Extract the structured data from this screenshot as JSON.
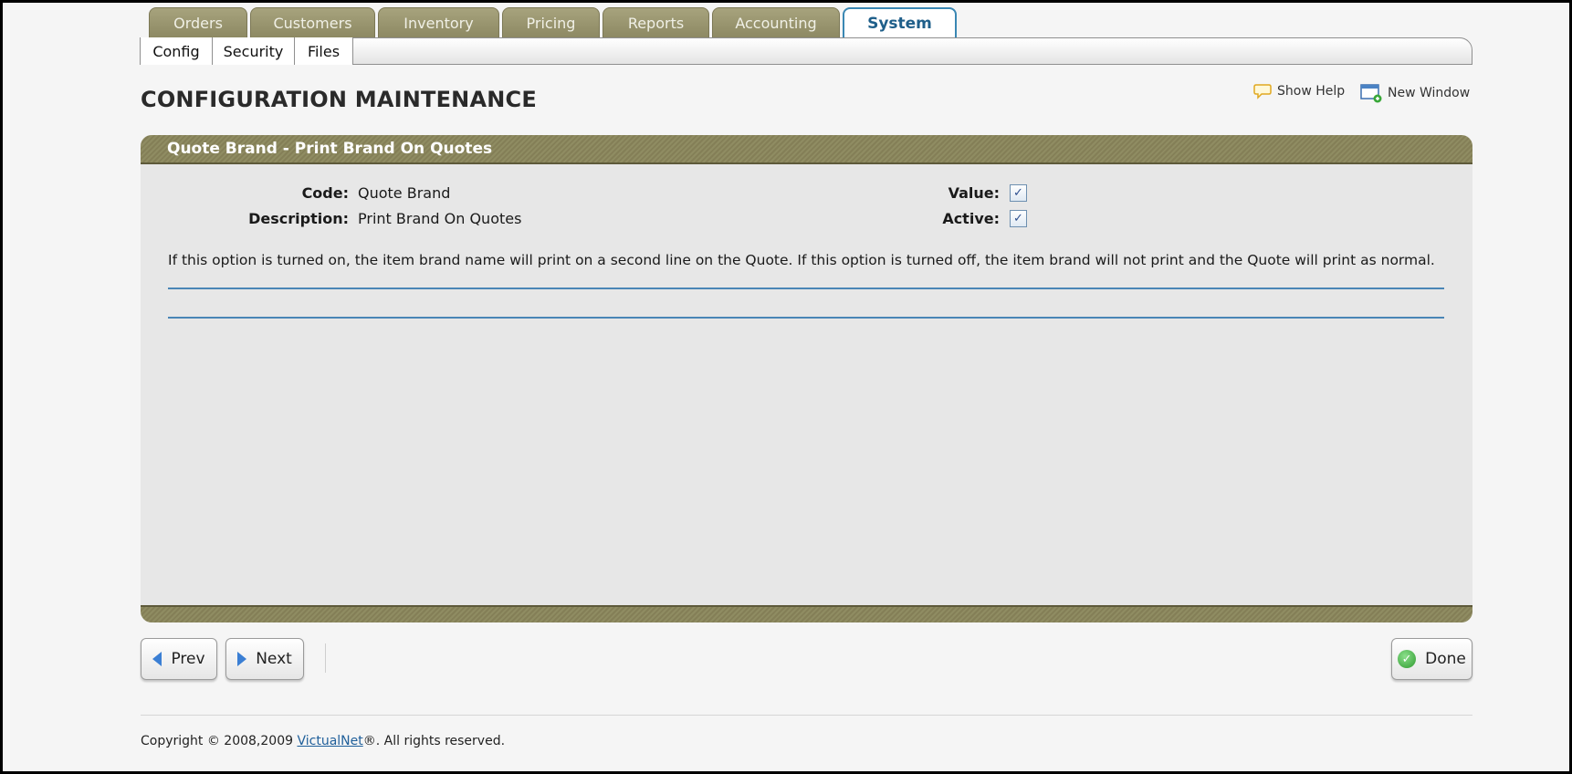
{
  "nav": {
    "tabs": [
      {
        "label": "Orders"
      },
      {
        "label": "Customers"
      },
      {
        "label": "Inventory"
      },
      {
        "label": "Pricing"
      },
      {
        "label": "Reports"
      },
      {
        "label": "Accounting"
      },
      {
        "label": "System"
      }
    ],
    "active_tab": "System",
    "subnav": [
      {
        "label": "Config"
      },
      {
        "label": "Security"
      },
      {
        "label": "Files"
      }
    ]
  },
  "page": {
    "title": "CONFIGURATION MAINTENANCE",
    "show_help": "Show Help",
    "new_window": "New Window"
  },
  "panel": {
    "header": "Quote Brand - Print Brand On Quotes",
    "code_label": "Code:",
    "code_value": "Quote Brand",
    "description_label": "Description:",
    "description_value": "Print Brand On Quotes",
    "value_label": "Value:",
    "value_checked": true,
    "active_label": "Active:",
    "active_checked": true,
    "help_text": "If this option is turned on, the item brand name will print on a second line on the Quote. If this option is turned off, the item brand will not print and the Quote will print as normal."
  },
  "buttons": {
    "prev": "Prev",
    "next": "Next",
    "done": "Done"
  },
  "footer": {
    "prefix": "Copyright © 2008,2009 ",
    "link": "VictualNet",
    "suffix": "®. All rights reserved."
  },
  "colors": {
    "tab_olive": "#8c8862",
    "active_tab_border": "#3a87b3",
    "panel_bg": "#e7e7e7",
    "divider_blue": "#4a86b6"
  }
}
